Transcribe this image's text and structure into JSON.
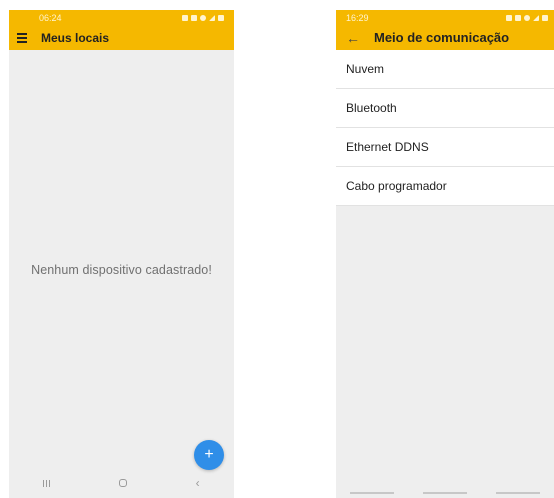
{
  "left_screen": {
    "status_bar": {
      "time": "06:24"
    },
    "app_bar": {
      "title": "Meus locais",
      "menu_icon": "hamburger-menu-icon"
    },
    "empty_message": "Nenhum dispositivo cadastrado!",
    "fab": {
      "label": "+",
      "color": "#2f8ee8"
    },
    "nav": {
      "recents": "recents-icon",
      "home": "home-icon",
      "back": "‹"
    }
  },
  "right_screen": {
    "status_bar": {
      "time": "16:29"
    },
    "app_bar": {
      "back_icon": "←",
      "title": "Meio de comunicação"
    },
    "options": [
      {
        "label": "Nuvem"
      },
      {
        "label": "Bluetooth"
      },
      {
        "label": "Ethernet DDNS"
      },
      {
        "label": "Cabo programador"
      }
    ]
  },
  "colors": {
    "accent": "#f5b800",
    "background": "#eeeeee",
    "fab": "#2f8ee8"
  }
}
